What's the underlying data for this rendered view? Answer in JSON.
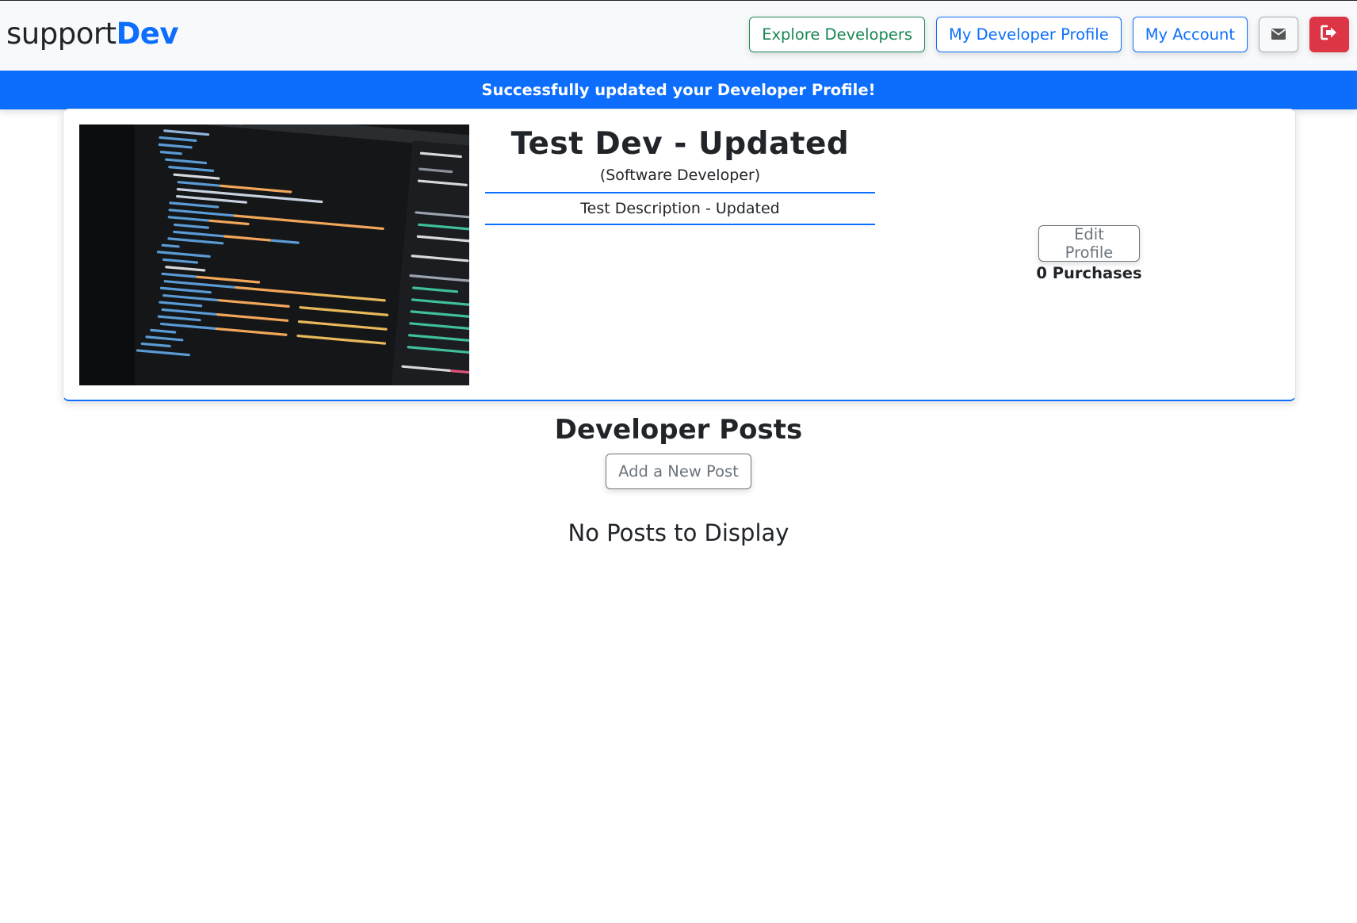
{
  "brand": {
    "prefix": "support",
    "suffix": "Dev"
  },
  "nav": {
    "explore": "Explore Developers",
    "profile": "My Developer Profile",
    "account": "My Account",
    "mail_icon": "envelope-icon",
    "logout_icon": "sign-out-icon"
  },
  "alert": {
    "message": "Successfully updated your Developer Profile!"
  },
  "profile": {
    "name": "Test Dev - Updated",
    "title": "(Software Developer)",
    "description": "Test Description - Updated",
    "edit_label": "Edit Profile",
    "purchases": "0 Purchases"
  },
  "posts": {
    "heading": "Developer Posts",
    "add_label": "Add a New Post",
    "empty_message": "No Posts to Display"
  },
  "colors": {
    "primary": "#0d6efd",
    "success": "#198754",
    "danger": "#dc3545",
    "secondary": "#6c757d",
    "navbar_bg": "#f8f9fa"
  }
}
